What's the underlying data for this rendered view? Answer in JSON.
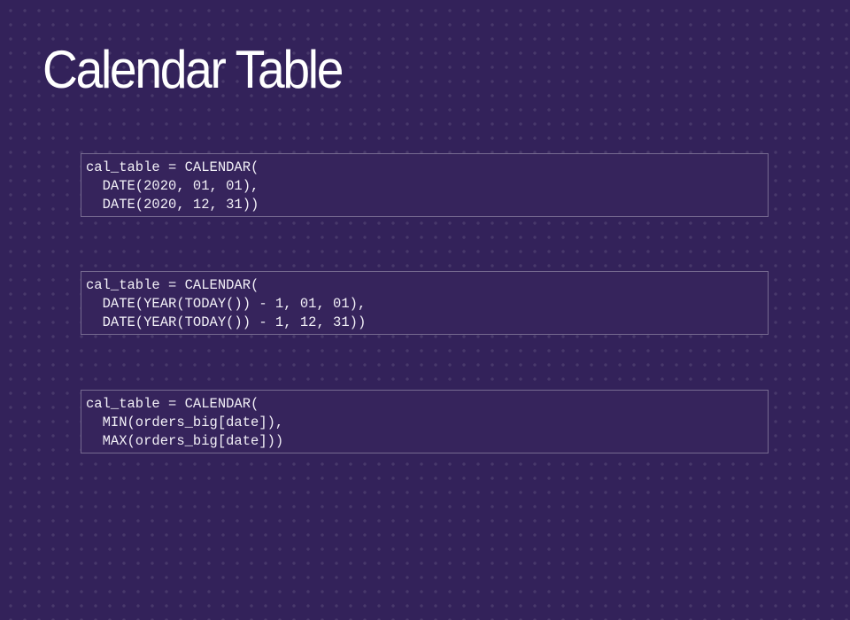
{
  "slide": {
    "title": "Calendar Table"
  },
  "code_blocks": [
    {
      "lines": [
        "cal_table = CALENDAR(",
        "  DATE(2020, 01, 01),",
        "  DATE(2020, 12, 31))"
      ]
    },
    {
      "lines": [
        "cal_table = CALENDAR(",
        "  DATE(YEAR(TODAY()) - 1, 01, 01),",
        "  DATE(YEAR(TODAY()) - 1, 12, 31))"
      ]
    },
    {
      "lines": [
        "cal_table = CALENDAR(",
        "  MIN(orders_big[date]),",
        "  MAX(orders_big[date]))"
      ]
    }
  ],
  "colors": {
    "background": "#33225a",
    "code_background": "#36245c",
    "text": "#ffffff"
  }
}
